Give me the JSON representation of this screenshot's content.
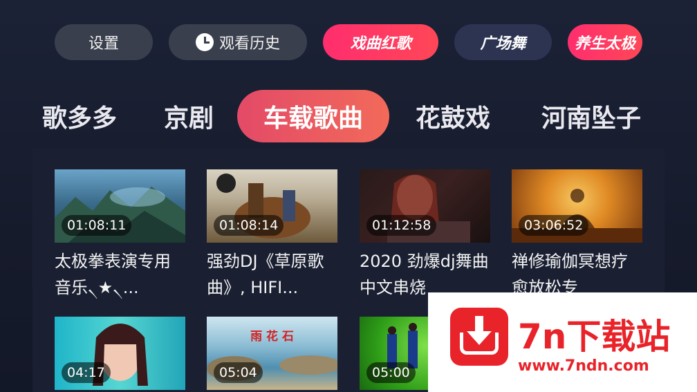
{
  "top_buttons": {
    "settings": "设置",
    "history": "观看历史",
    "opera": "戏曲红歌",
    "square_dance": "广场舞",
    "taiji": "养生太极"
  },
  "tabs": [
    "歌多多",
    "京剧",
    "车载歌曲",
    "花鼓戏",
    "河南坠子"
  ],
  "active_tab": "车载歌曲",
  "videos": [
    {
      "duration": "01:08:11",
      "title": "太极拳表演专用音乐৲★৲..."
    },
    {
      "duration": "01:08:14",
      "title": "强劲DJ《草原歌曲》, HIFI..."
    },
    {
      "duration": "01:12:58",
      "title": "2020 劲爆dj舞曲中文串烧"
    },
    {
      "duration": "03:06:52",
      "title": "禅修瑜伽冥想疗愈放松专"
    },
    {
      "duration": "04:17",
      "title": ""
    },
    {
      "duration": "05:04",
      "title": "",
      "thumb_text": "雨 花 石"
    },
    {
      "duration": "05:00",
      "title": ""
    }
  ],
  "promo": {
    "name": "7n下载站",
    "url": "www.7ndn.com"
  },
  "colors": {
    "accent": "#ff2d6e",
    "active_tab": "#e34a67",
    "background": "#1a2032",
    "promo_red": "#e8232a"
  }
}
